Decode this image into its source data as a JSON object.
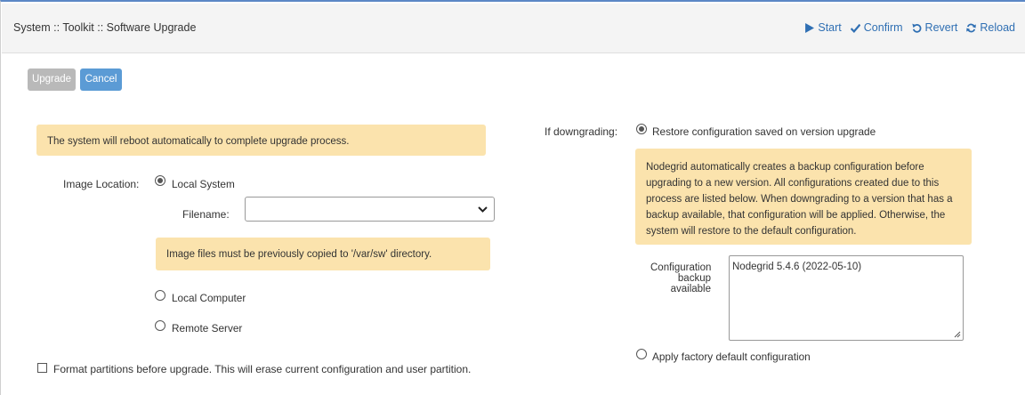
{
  "header": {
    "breadcrumb": "System :: Toolkit :: Software Upgrade",
    "actions": [
      {
        "label": "Start",
        "icon": "play-icon"
      },
      {
        "label": "Confirm",
        "icon": "check-icon"
      },
      {
        "label": "Revert",
        "icon": "revert-icon"
      },
      {
        "label": "Reload",
        "icon": "reload-icon"
      }
    ]
  },
  "toolbar": {
    "upgrade_label": "Upgrade",
    "cancel_label": "Cancel"
  },
  "left": {
    "reboot_note": "The system will reboot automatically to complete upgrade process.",
    "image_location_label": "Image Location:",
    "local_system_label": "Local System",
    "filename_label": "Filename:",
    "filename_value": "",
    "image_note": "Image files must be previously copied to '/var/sw' directory.",
    "local_computer_label": "Local Computer",
    "remote_server_label": "Remote Server",
    "format_label": "Format partitions before upgrade. This will erase current configuration and user partition."
  },
  "right": {
    "downgrading_label": "If downgrading:",
    "restore_label": "Restore configuration saved on version upgrade",
    "backup_note": "Nodegrid automatically creates a backup configuration before upgrading to a new version. All configurations created due to this process are listed below. When downgrading to a version that has a backup available, that configuration will be applied. Otherwise, the system will restore to the default configuration.",
    "config_backup_label": "Configuration backup available",
    "config_backup_items": [
      "Nodegrid 5.4.6 (2022-05-10)"
    ],
    "factory_label": "Apply factory default configuration"
  },
  "state": {
    "image_location": "Local System",
    "downgrade_option": "Restore configuration saved on version upgrade",
    "format_partitions": false
  },
  "colors": {
    "accent": "#2f6fb3",
    "note_background": "#fbe3ad",
    "cancel_button": "#5b9bd5",
    "upgrade_button_disabled": "#b9b9b9"
  }
}
